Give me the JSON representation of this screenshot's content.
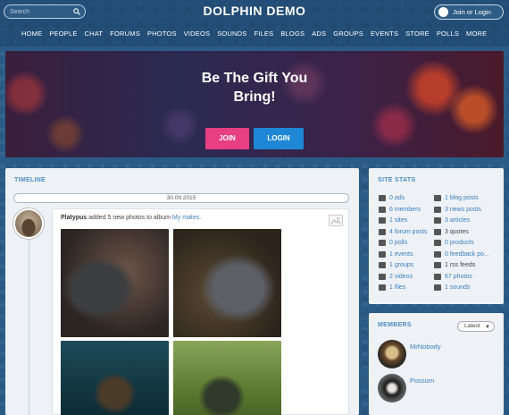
{
  "header": {
    "search_placeholder": "Search",
    "brand": "DOLPHIN DEMO",
    "join_login": "Join or Login",
    "nav": [
      "HOME",
      "PEOPLE",
      "CHAT",
      "FORUMS",
      "PHOTOS",
      "VIDEOS",
      "SOUNDS",
      "FILES",
      "BLOGS",
      "ADS",
      "GROUPS",
      "EVENTS",
      "STORE",
      "POLLS",
      "MORE"
    ]
  },
  "hero": {
    "headline_line1": "Be The Gift You",
    "headline_line2": "Bring!",
    "join_label": "JOIN",
    "login_label": "LOGIN"
  },
  "timeline": {
    "title": "TIMELINE",
    "date": "30.09.2015",
    "post": {
      "author": "Platypus",
      "action": " added 5 new photos to album ",
      "album": "My mates."
    }
  },
  "site_stats": {
    "title": "SITE STATS",
    "items": [
      {
        "label": "0 ads",
        "icon": "ads-icon"
      },
      {
        "label": "1 blog posts",
        "icon": "blog-icon"
      },
      {
        "label": "6 members",
        "icon": "members-icon"
      },
      {
        "label": "3 news posts",
        "icon": "news-icon"
      },
      {
        "label": "1 sites",
        "icon": "sites-icon"
      },
      {
        "label": "3 articles",
        "icon": "articles-icon"
      },
      {
        "label": "4 forum posts",
        "icon": "forum-icon"
      },
      {
        "label": "3 quotes",
        "icon": "quotes-icon"
      },
      {
        "label": "0 polls",
        "icon": "polls-icon"
      },
      {
        "label": "0 products",
        "icon": "products-icon"
      },
      {
        "label": "1 events",
        "icon": "events-icon"
      },
      {
        "label": "0 feedback po...",
        "icon": "feedback-icon"
      },
      {
        "label": "1 groups",
        "icon": "groups-icon"
      },
      {
        "label": "1 rss feeds",
        "icon": "rss-icon"
      },
      {
        "label": "2 videos",
        "icon": "videos-icon"
      },
      {
        "label": "67 photos",
        "icon": "photos-icon"
      },
      {
        "label": "1 files",
        "icon": "files-icon"
      },
      {
        "label": "1 sounds",
        "icon": "sounds-icon"
      }
    ]
  },
  "members": {
    "title": "MEMBERS",
    "filter": "Latest",
    "list": [
      {
        "name": "MrNobody"
      },
      {
        "name": "Possum"
      }
    ]
  },
  "colors": {
    "brand_blue": "#1e88d6",
    "join_pink": "#e83e82",
    "link": "#3a7fbf"
  }
}
